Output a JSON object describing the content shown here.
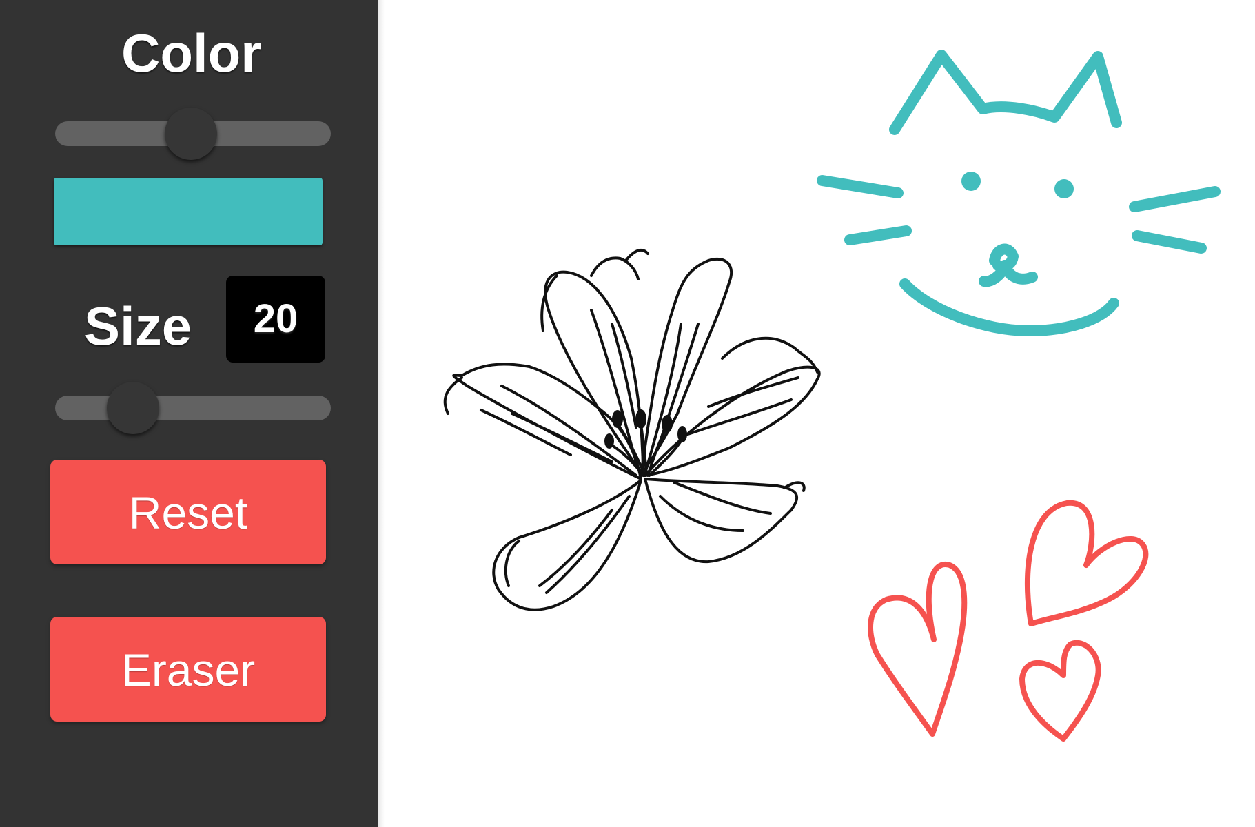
{
  "sidebar": {
    "color_label": "Color",
    "color_slider_value": 0.49,
    "swatch_color": "#42bdbd",
    "size_label": "Size",
    "size_value": "20",
    "size_slider_value": 0.23,
    "reset_label": "Reset",
    "eraser_label": "Eraser"
  },
  "canvas": {
    "drawings": [
      {
        "name": "flower-drawing",
        "stroke": "#111111"
      },
      {
        "name": "cat-face-drawing",
        "stroke": "#42bdbd"
      },
      {
        "name": "hearts-drawing",
        "stroke": "#f5524f"
      }
    ]
  }
}
